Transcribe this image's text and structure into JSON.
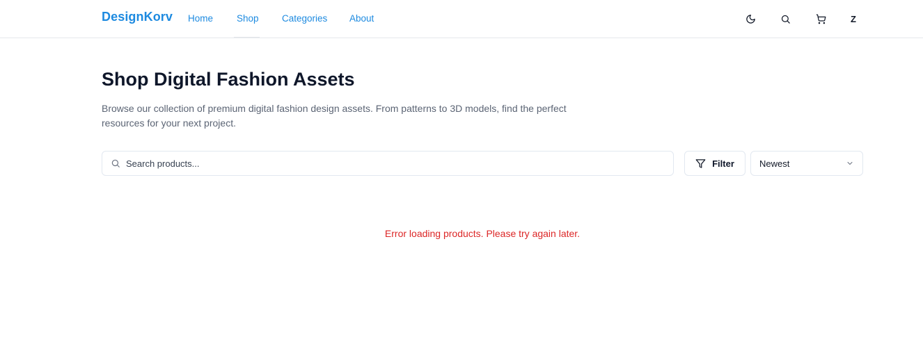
{
  "header": {
    "brand": "DesignKorv",
    "nav": {
      "home": "Home",
      "shop": "Shop",
      "categories": "Categories",
      "about": "About"
    },
    "active_nav": "shop",
    "icons": [
      "moon-icon",
      "search-icon",
      "cart-icon"
    ],
    "avatar_initial": "Z"
  },
  "main": {
    "title": "Shop Digital Fashion Assets",
    "description": "Browse our collection of premium digital fashion design assets. From patterns to 3D models, find the perfect resources for your next project.",
    "search": {
      "placeholder": "Search products...",
      "value": ""
    },
    "filter_label": "Filter",
    "sort": {
      "selected": "Newest"
    },
    "error_message": "Error loading products. Please try again later."
  },
  "colors": {
    "brand": "#1d8ae0",
    "error": "#dc2626",
    "border": "#e2e8f0",
    "text_primary": "#0f172a",
    "text_muted": "#5b6474"
  }
}
